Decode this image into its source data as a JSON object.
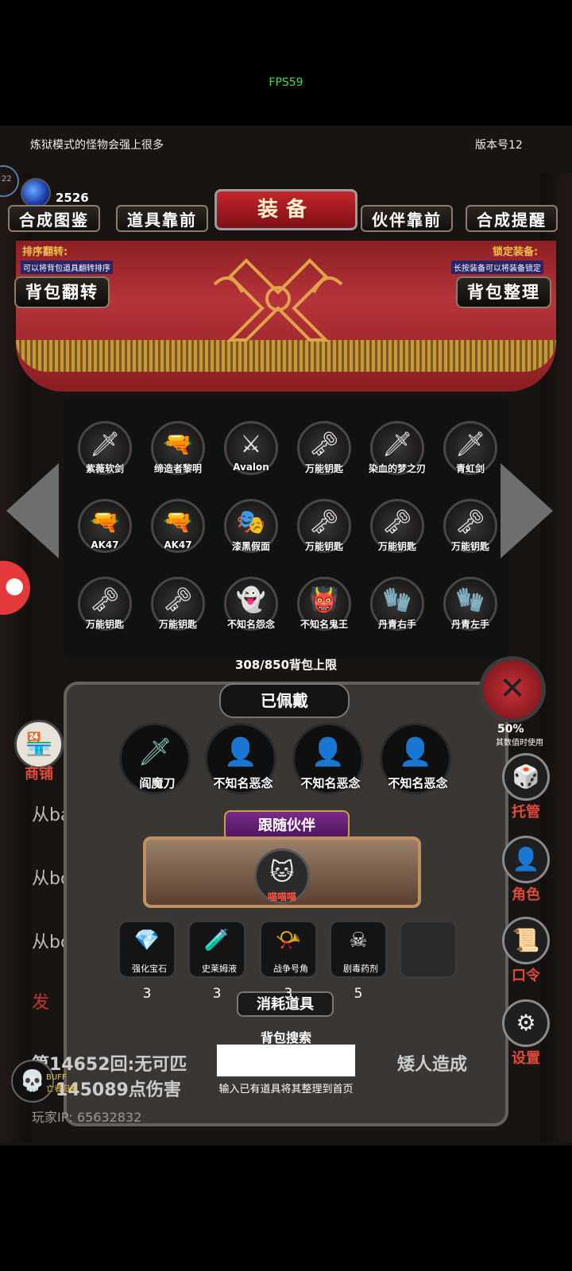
{
  "fps": "FPS59",
  "header": {
    "notice": "炼狱模式的怪物会强上很多",
    "version": "版本号12",
    "gem_count": "2526",
    "left_ring_text": "22"
  },
  "tabs": {
    "title": "装备",
    "synthesis_guide": "合成图鉴",
    "items_front": "道具靠前",
    "companion_front": "伙伴靠前",
    "synthesis_remind": "合成提醒"
  },
  "sort": {
    "flip_label": "排序翻转:",
    "flip_desc": "可以将背包道具翻转排序",
    "lock_label": "锁定装备:",
    "lock_desc": "长按装备可以将装备锁定",
    "flip_button": "背包翻转",
    "organize_button": "背包整理"
  },
  "inventory": [
    {
      "name": "紫薇软剑",
      "icon": "🗡"
    },
    {
      "name": "缔造者黎明",
      "icon": "🔫"
    },
    {
      "name": "Avalon",
      "icon": "⚔"
    },
    {
      "name": "万能钥匙",
      "icon": "🗝"
    },
    {
      "name": "染血的梦之刃",
      "icon": "🗡"
    },
    {
      "name": "青虹剑",
      "icon": "🗡"
    },
    {
      "name": "AK47",
      "icon": "🔫"
    },
    {
      "name": "AK47",
      "icon": "🔫"
    },
    {
      "name": "漆黑假面",
      "icon": "🎭"
    },
    {
      "name": "万能钥匙",
      "icon": "🗝"
    },
    {
      "name": "万能钥匙",
      "icon": "🗝"
    },
    {
      "name": "万能钥匙",
      "icon": "🗝"
    },
    {
      "name": "万能钥匙",
      "icon": "🗝"
    },
    {
      "name": "万能钥匙",
      "icon": "🗝"
    },
    {
      "name": "不知名怨念",
      "icon": "👻"
    },
    {
      "name": "不知名鬼王",
      "icon": "👹"
    },
    {
      "name": "丹青右手",
      "icon": "🧤"
    },
    {
      "name": "丹青左手",
      "icon": "🧤"
    }
  ],
  "capacity": "308/850背包上限",
  "equipped": {
    "title": "已佩戴",
    "items": [
      {
        "name": "阎魔刀",
        "icon": "🗡"
      },
      {
        "name": "不知名恶念",
        "icon": "👤"
      },
      {
        "name": "不知名恶念",
        "icon": "👤"
      },
      {
        "name": "不知名恶念",
        "icon": "👤"
      }
    ]
  },
  "companion": {
    "title": "跟随伙伴",
    "name": "喵喵喵",
    "icon": "🐱"
  },
  "consumables": {
    "title": "消耗道具",
    "items": [
      {
        "name": "强化宝石",
        "count": "3",
        "icon": "💎"
      },
      {
        "name": "史莱姆液",
        "count": "3",
        "icon": "🧪"
      },
      {
        "name": "战争号角",
        "count": "3",
        "icon": "📯"
      },
      {
        "name": "剧毒药剂",
        "count": "5",
        "icon": "☠"
      }
    ]
  },
  "search": {
    "label": "背包搜索",
    "value": "",
    "hint": "输入已有道具将其整理到首页"
  },
  "right_menu": {
    "stat_text": "其数值时使用",
    "stat_number": "50%",
    "hosting": "托管",
    "role": "角色",
    "command": "口令",
    "settings": "设置"
  },
  "left_menu": {
    "shop": "商铺",
    "buff_label": "BUFF",
    "buff_sub": "亡者归来"
  },
  "log": [
    "从ba",
    "从bo",
    "从bo",
    "发",
    "第14652回:无可匹",
    "矮人造成",
    "145089点伤害"
  ],
  "player_ip": "玩家IP:  65632832"
}
